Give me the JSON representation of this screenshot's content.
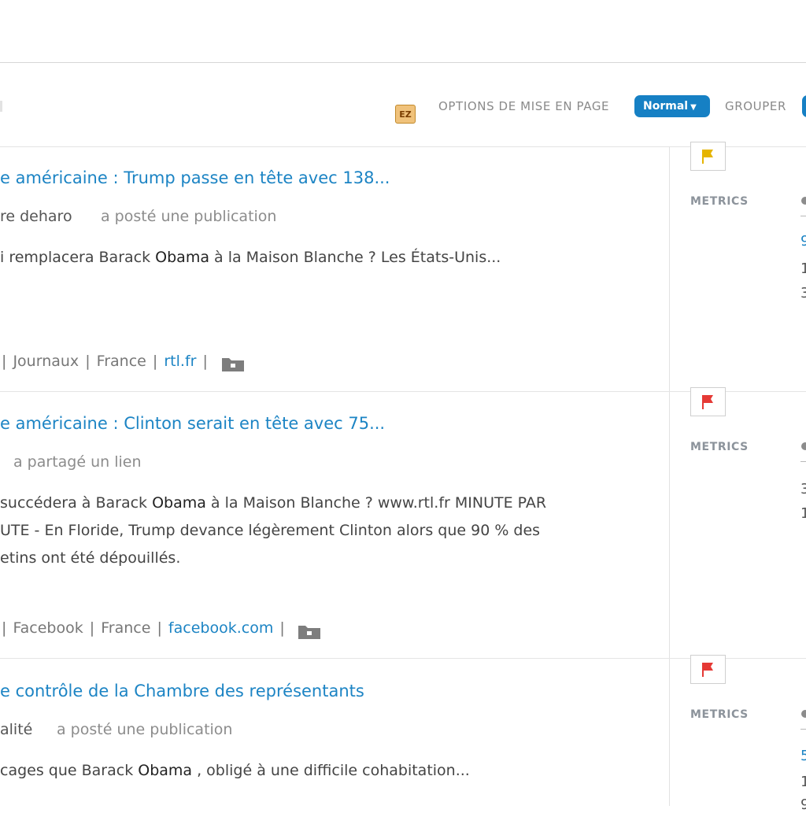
{
  "toolbar": {
    "ez_label": "EZ",
    "layout_options_label": "OPTIONS DE MISE EN PAGE",
    "layout_select_value": "Normal",
    "group_label": "GROUPER"
  },
  "results": [
    {
      "title": "e américaine : Trump passe en tête avec 138...",
      "author": "re deharo",
      "action": "a posté une publication",
      "excerpt_lines": [
        {
          "pre": "i remplacera Barack ",
          "bold": "Obama",
          "post": " à la Maison Blanche ? Les États-Unis..."
        }
      ],
      "source": {
        "category": "Journaux",
        "country": "France",
        "domain": "rtl.fr"
      },
      "flag_color": "#e5b400",
      "metrics_label": "METRICS",
      "metric_values": [
        "9",
        "1",
        "3"
      ]
    },
    {
      "title": "e américaine : Clinton serait en tête avec 75...",
      "author": "",
      "action": "a partagé un lien",
      "excerpt_lines": [
        {
          "pre": "succédera à Barack ",
          "bold": "Obama",
          "post": " à la Maison Blanche ? www.rtl.fr MINUTE PAR"
        },
        {
          "pre": "UTE - En Floride, Trump devance légèrement Clinton alors que 90 % des",
          "bold": "",
          "post": ""
        },
        {
          "pre": "etins ont été dépouillés.",
          "bold": "",
          "post": ""
        }
      ],
      "source": {
        "category": "Facebook",
        "country": "France",
        "domain": "facebook.com"
      },
      "flag_color": "#e53935",
      "metrics_label": "METRICS",
      "metric_values": [
        "3",
        "1"
      ]
    },
    {
      "title": "e contrôle de la Chambre des représentants",
      "author": "alité",
      "action": "a posté une publication",
      "excerpt_lines": [
        {
          "pre": "cages que Barack ",
          "bold": "Obama",
          "post": " , obligé à une difficile cohabitation..."
        }
      ],
      "source": null,
      "flag_color": "#e53935",
      "metrics_label": "METRICS",
      "metric_values": [
        "5",
        "1",
        "9"
      ]
    }
  ]
}
